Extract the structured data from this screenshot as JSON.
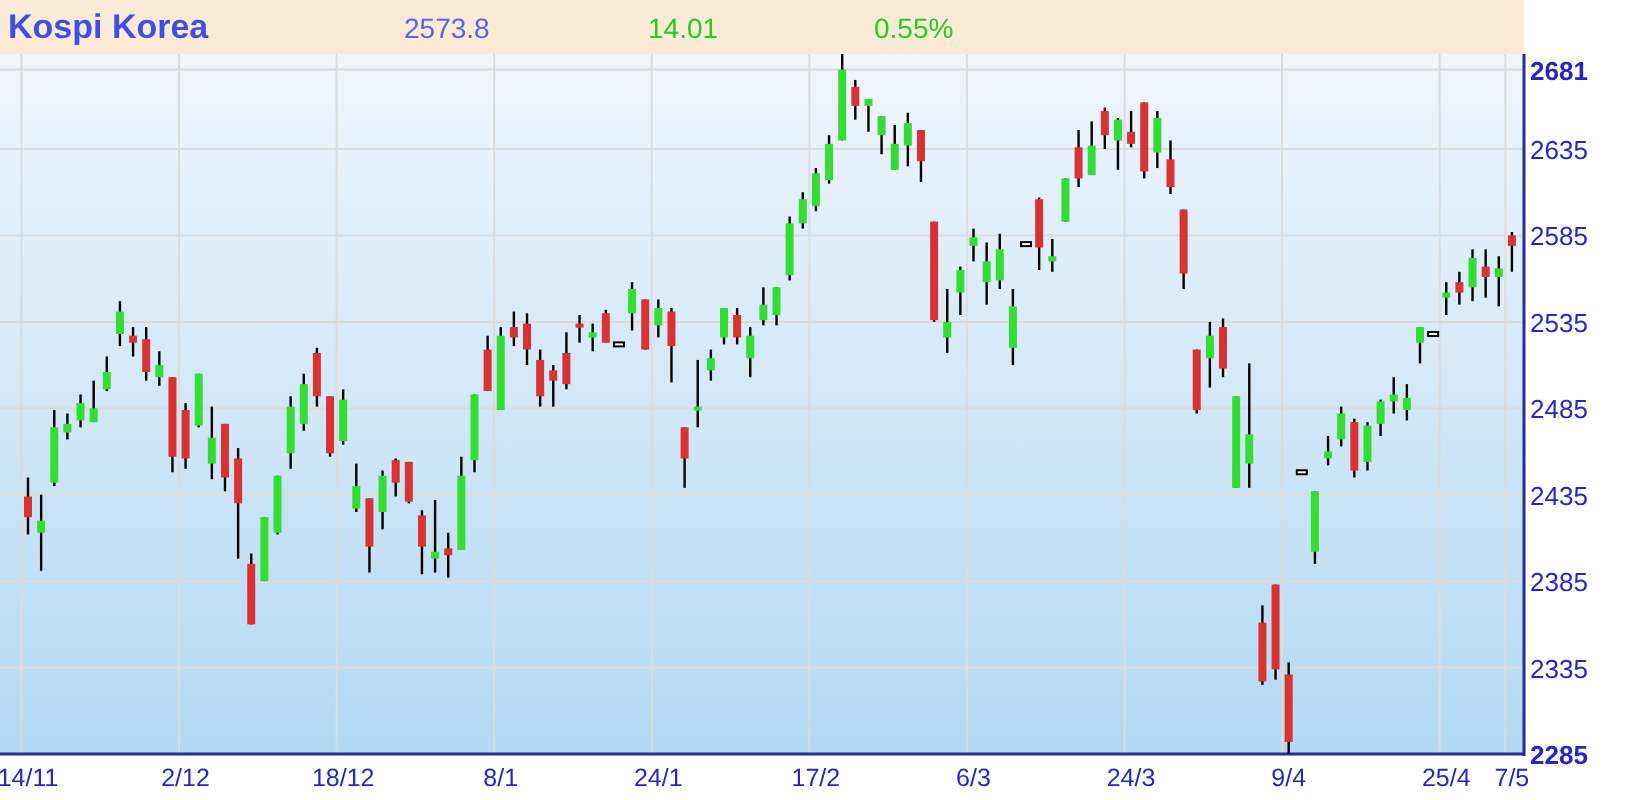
{
  "header": {
    "title": "Kospi Korea",
    "price": "2573.8",
    "change": "14.01",
    "change_percent": "0.55%"
  },
  "chart_data": {
    "type": "candlestick",
    "grid": true,
    "ylim": [
      2285,
      2690
    ],
    "yticks": [
      2285,
      2335,
      2385,
      2435,
      2485,
      2535,
      2585,
      2635,
      2681
    ],
    "categories": [
      "14/11",
      null,
      null,
      null,
      null,
      null,
      null,
      null,
      null,
      null,
      null,
      null,
      "2/12",
      null,
      null,
      null,
      null,
      null,
      null,
      null,
      null,
      null,
      null,
      null,
      "18/12",
      null,
      null,
      null,
      null,
      null,
      null,
      null,
      null,
      null,
      null,
      null,
      "8/1",
      null,
      null,
      null,
      null,
      null,
      null,
      null,
      null,
      null,
      null,
      null,
      "24/1",
      null,
      null,
      null,
      null,
      null,
      null,
      null,
      null,
      null,
      null,
      null,
      "17/2",
      null,
      null,
      null,
      null,
      null,
      null,
      null,
      null,
      null,
      null,
      null,
      "6/3",
      null,
      null,
      null,
      null,
      null,
      null,
      null,
      null,
      null,
      null,
      null,
      "24/3",
      null,
      null,
      null,
      null,
      null,
      null,
      null,
      null,
      null,
      null,
      null,
      "9/4",
      null,
      null,
      null,
      null,
      null,
      null,
      null,
      null,
      null,
      null,
      null,
      "25/4",
      null,
      null,
      null,
      null,
      "7/5"
    ],
    "ohlc": [
      [
        2434,
        2445,
        2412,
        2422
      ],
      [
        2413,
        2435,
        2391,
        2420
      ],
      [
        2442,
        2484,
        2440,
        2474
      ],
      [
        2471,
        2482,
        2467,
        2476
      ],
      [
        2478,
        2493,
        2474,
        2488
      ],
      [
        2477,
        2501,
        2477,
        2485
      ],
      [
        2496,
        2515,
        2495,
        2506
      ],
      [
        2528,
        2547,
        2521,
        2541
      ],
      [
        2527,
        2532,
        2515,
        2523
      ],
      [
        2525,
        2532,
        2501,
        2506
      ],
      [
        2503,
        2518,
        2498,
        2510
      ],
      [
        2503,
        2503,
        2448,
        2457
      ],
      [
        2484,
        2488,
        2450,
        2456
      ],
      [
        2475,
        2505,
        2474,
        2505
      ],
      [
        2453,
        2486,
        2444,
        2468
      ],
      [
        2476,
        2476,
        2437,
        2445
      ],
      [
        2456,
        2462,
        2398,
        2430
      ],
      [
        2395,
        2401,
        2360,
        2360
      ],
      [
        2385,
        2422,
        2385,
        2422
      ],
      [
        2413,
        2446,
        2412,
        2446
      ],
      [
        2459,
        2492,
        2450,
        2486
      ],
      [
        2476,
        2505,
        2472,
        2499
      ],
      [
        2517,
        2520,
        2486,
        2492
      ],
      [
        2492,
        2492,
        2457,
        2459
      ],
      [
        2466,
        2496,
        2464,
        2490
      ],
      [
        2427,
        2453,
        2425,
        2440
      ],
      [
        2433,
        2433,
        2390,
        2405
      ],
      [
        2425,
        2449,
        2415,
        2446
      ],
      [
        2455,
        2456,
        2434,
        2442
      ],
      [
        2454,
        2454,
        2430,
        2431
      ],
      [
        2423,
        2426,
        2389,
        2405
      ],
      [
        2398,
        2432,
        2390,
        2402
      ],
      [
        2404,
        2413,
        2387,
        2400
      ],
      [
        2403,
        2457,
        2403,
        2446
      ],
      [
        2455,
        2493,
        2448,
        2493
      ],
      [
        2519,
        2527,
        2495,
        2495
      ],
      [
        2484,
        2532,
        2484,
        2527
      ],
      [
        2532,
        2541,
        2521,
        2526
      ],
      [
        2534,
        2540,
        2510,
        2519
      ],
      [
        2513,
        2519,
        2486,
        2492
      ],
      [
        2507,
        2510,
        2486,
        2501
      ],
      [
        2517,
        2529,
        2496,
        2499
      ],
      [
        2534,
        2539,
        2523,
        2532
      ],
      [
        2526,
        2534,
        2518,
        2529
      ],
      [
        2540,
        2542,
        2523,
        2523
      ],
      [
        2522,
        2522,
        2522,
        2522
      ],
      [
        2540,
        2558,
        2530,
        2554
      ],
      [
        2548,
        2548,
        2519,
        2519
      ],
      [
        2533,
        2548,
        2526,
        2543
      ],
      [
        2541,
        2543,
        2500,
        2521
      ],
      [
        2474,
        2474,
        2439,
        2456
      ],
      [
        2484,
        2513,
        2474,
        2486
      ],
      [
        2507,
        2519,
        2501,
        2514
      ],
      [
        2526,
        2543,
        2522,
        2543
      ],
      [
        2539,
        2543,
        2522,
        2526
      ],
      [
        2514,
        2532,
        2503,
        2527
      ],
      [
        2536,
        2555,
        2533,
        2545
      ],
      [
        2539,
        2555,
        2533,
        2555
      ],
      [
        2562,
        2596,
        2559,
        2592
      ],
      [
        2592,
        2610,
        2589,
        2606
      ],
      [
        2602,
        2624,
        2599,
        2621
      ],
      [
        2617,
        2643,
        2615,
        2638
      ],
      [
        2640,
        2690,
        2640,
        2681
      ],
      [
        2671,
        2675,
        2652,
        2660
      ],
      [
        2660,
        2664,
        2645,
        2664
      ],
      [
        2643,
        2654,
        2632,
        2654
      ],
      [
        2623,
        2649,
        2623,
        2638
      ],
      [
        2637,
        2656,
        2625,
        2650
      ],
      [
        2646,
        2646,
        2616,
        2628
      ],
      [
        2593,
        2593,
        2535,
        2536
      ],
      [
        2526,
        2554,
        2517,
        2535
      ],
      [
        2552,
        2567,
        2539,
        2565
      ],
      [
        2579,
        2589,
        2570,
        2584
      ],
      [
        2558,
        2581,
        2545,
        2570
      ],
      [
        2559,
        2586,
        2554,
        2577
      ],
      [
        2520,
        2554,
        2510,
        2544
      ],
      [
        2580,
        2580,
        2580,
        2580
      ],
      [
        2606,
        2607,
        2565,
        2578
      ],
      [
        2570,
        2583,
        2564,
        2573
      ],
      [
        2593,
        2618,
        2593,
        2618
      ],
      [
        2636,
        2646,
        2613,
        2618
      ],
      [
        2620,
        2651,
        2620,
        2637
      ],
      [
        2657,
        2659,
        2635,
        2643
      ],
      [
        2640,
        2653,
        2623,
        2652
      ],
      [
        2645,
        2657,
        2636,
        2638
      ],
      [
        2662,
        2662,
        2618,
        2622
      ],
      [
        2633,
        2657,
        2624,
        2653
      ],
      [
        2629,
        2640,
        2609,
        2613
      ],
      [
        2600,
        2600,
        2554,
        2563
      ],
      [
        2519,
        2519,
        2482,
        2484
      ],
      [
        2514,
        2535,
        2497,
        2527
      ],
      [
        2532,
        2537,
        2503,
        2508
      ],
      [
        2439,
        2492,
        2439,
        2492
      ],
      [
        2453,
        2511,
        2439,
        2470
      ],
      [
        2361,
        2371,
        2325,
        2327
      ],
      [
        2383,
        2383,
        2328,
        2334
      ],
      [
        2331,
        2338,
        2285,
        2292
      ],
      [
        2448,
        2448,
        2448,
        2448
      ],
      [
        2402,
        2437,
        2395,
        2437
      ],
      [
        2456,
        2469,
        2452,
        2460
      ],
      [
        2467,
        2486,
        2463,
        2482
      ],
      [
        2477,
        2479,
        2445,
        2449
      ],
      [
        2454,
        2477,
        2449,
        2475
      ],
      [
        2476,
        2490,
        2469,
        2489
      ],
      [
        2489,
        2503,
        2482,
        2493
      ],
      [
        2484,
        2499,
        2478,
        2491
      ],
      [
        2523,
        2532,
        2511,
        2532
      ],
      [
        2528,
        2528,
        2528,
        2528
      ],
      [
        2549,
        2558,
        2539,
        2552
      ],
      [
        2558,
        2564,
        2545,
        2552
      ],
      [
        2555,
        2577,
        2547,
        2572
      ],
      [
        2567,
        2577,
        2549,
        2561
      ],
      [
        2561,
        2573,
        2544,
        2566
      ],
      [
        2585,
        2587,
        2564,
        2579
      ]
    ]
  }
}
